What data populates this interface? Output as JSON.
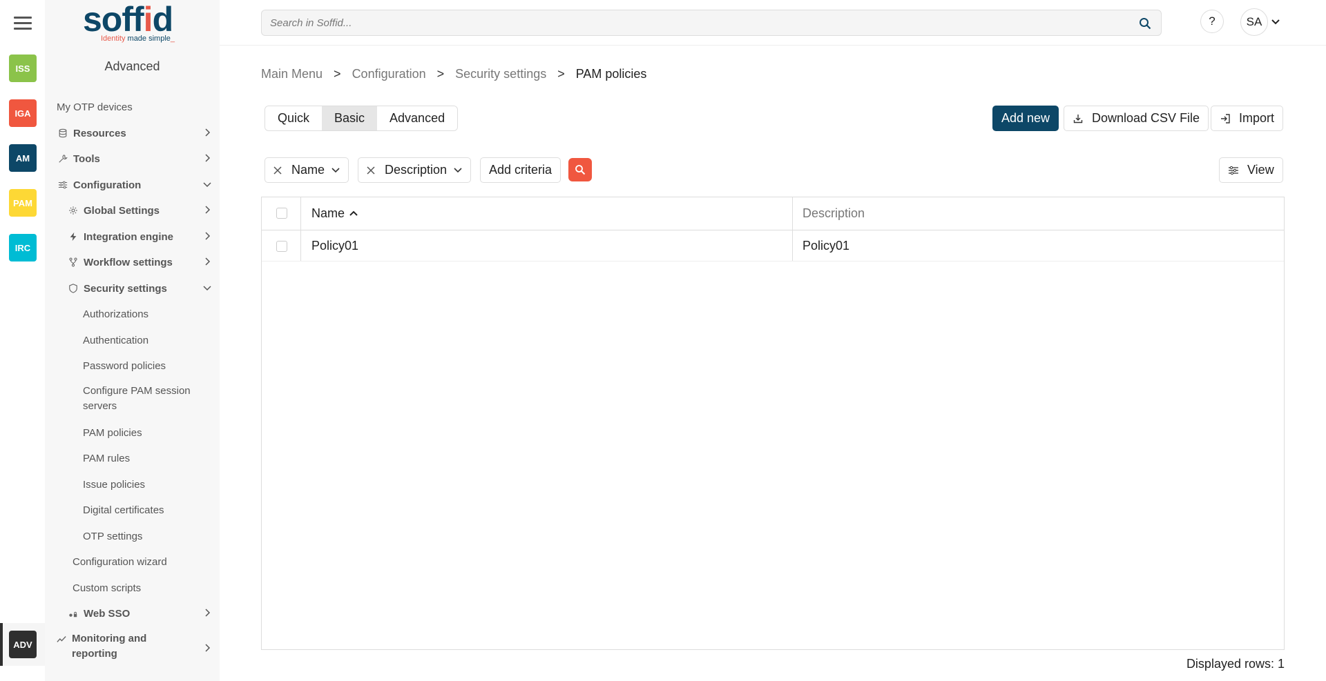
{
  "rail": {
    "apps": [
      {
        "label": "ISS",
        "color": "#8bc34a"
      },
      {
        "label": "IGA",
        "color": "#f0573f"
      },
      {
        "label": "AM",
        "color": "#0d4767"
      },
      {
        "label": "PAM",
        "color": "#fdd835"
      },
      {
        "label": "IRC",
        "color": "#00bcd4"
      },
      {
        "label": "ADV",
        "color": "#2f2f2f"
      }
    ]
  },
  "brand": {
    "logo_text": "soffid",
    "tag_red": "Identity ",
    "tag_blue": "made simple",
    "tag_end": "_"
  },
  "sidebar": {
    "title": "Advanced",
    "items": [
      {
        "label": "My OTP devices"
      },
      {
        "label": "Resources"
      },
      {
        "label": "Tools"
      },
      {
        "label": "Configuration"
      },
      {
        "label": "Global Settings"
      },
      {
        "label": "Integration engine"
      },
      {
        "label": "Workflow settings"
      },
      {
        "label": "Security settings"
      },
      {
        "label": "Authorizations"
      },
      {
        "label": "Authentication"
      },
      {
        "label": "Password policies"
      },
      {
        "label": "Configure PAM session servers"
      },
      {
        "label": "PAM policies"
      },
      {
        "label": "PAM rules"
      },
      {
        "label": "Issue policies"
      },
      {
        "label": "Digital certificates"
      },
      {
        "label": "OTP settings"
      },
      {
        "label": "Configuration wizard"
      },
      {
        "label": "Custom scripts"
      },
      {
        "label": "Web SSO"
      },
      {
        "label": "Monitoring and reporting"
      }
    ]
  },
  "header": {
    "search_placeholder": "Search in Soffid...",
    "help_label": "?",
    "user_initials": "SA"
  },
  "breadcrumb": [
    "Main Menu",
    "Configuration",
    "Security settings",
    "PAM policies"
  ],
  "breadcrumb_sep": ">",
  "modes": [
    "Quick",
    "Basic",
    "Advanced"
  ],
  "actions": {
    "add_new": "Add new",
    "download_csv": "Download CSV File",
    "import": "Import",
    "view": "View"
  },
  "filters": {
    "name": "Name",
    "description": "Description",
    "add_criteria": "Add criteria"
  },
  "table": {
    "columns": [
      "Name",
      "Description"
    ],
    "rows": [
      {
        "name": "Policy01",
        "description": "Policy01"
      }
    ]
  },
  "footer": {
    "displayed_rows": "Displayed rows: 1"
  }
}
